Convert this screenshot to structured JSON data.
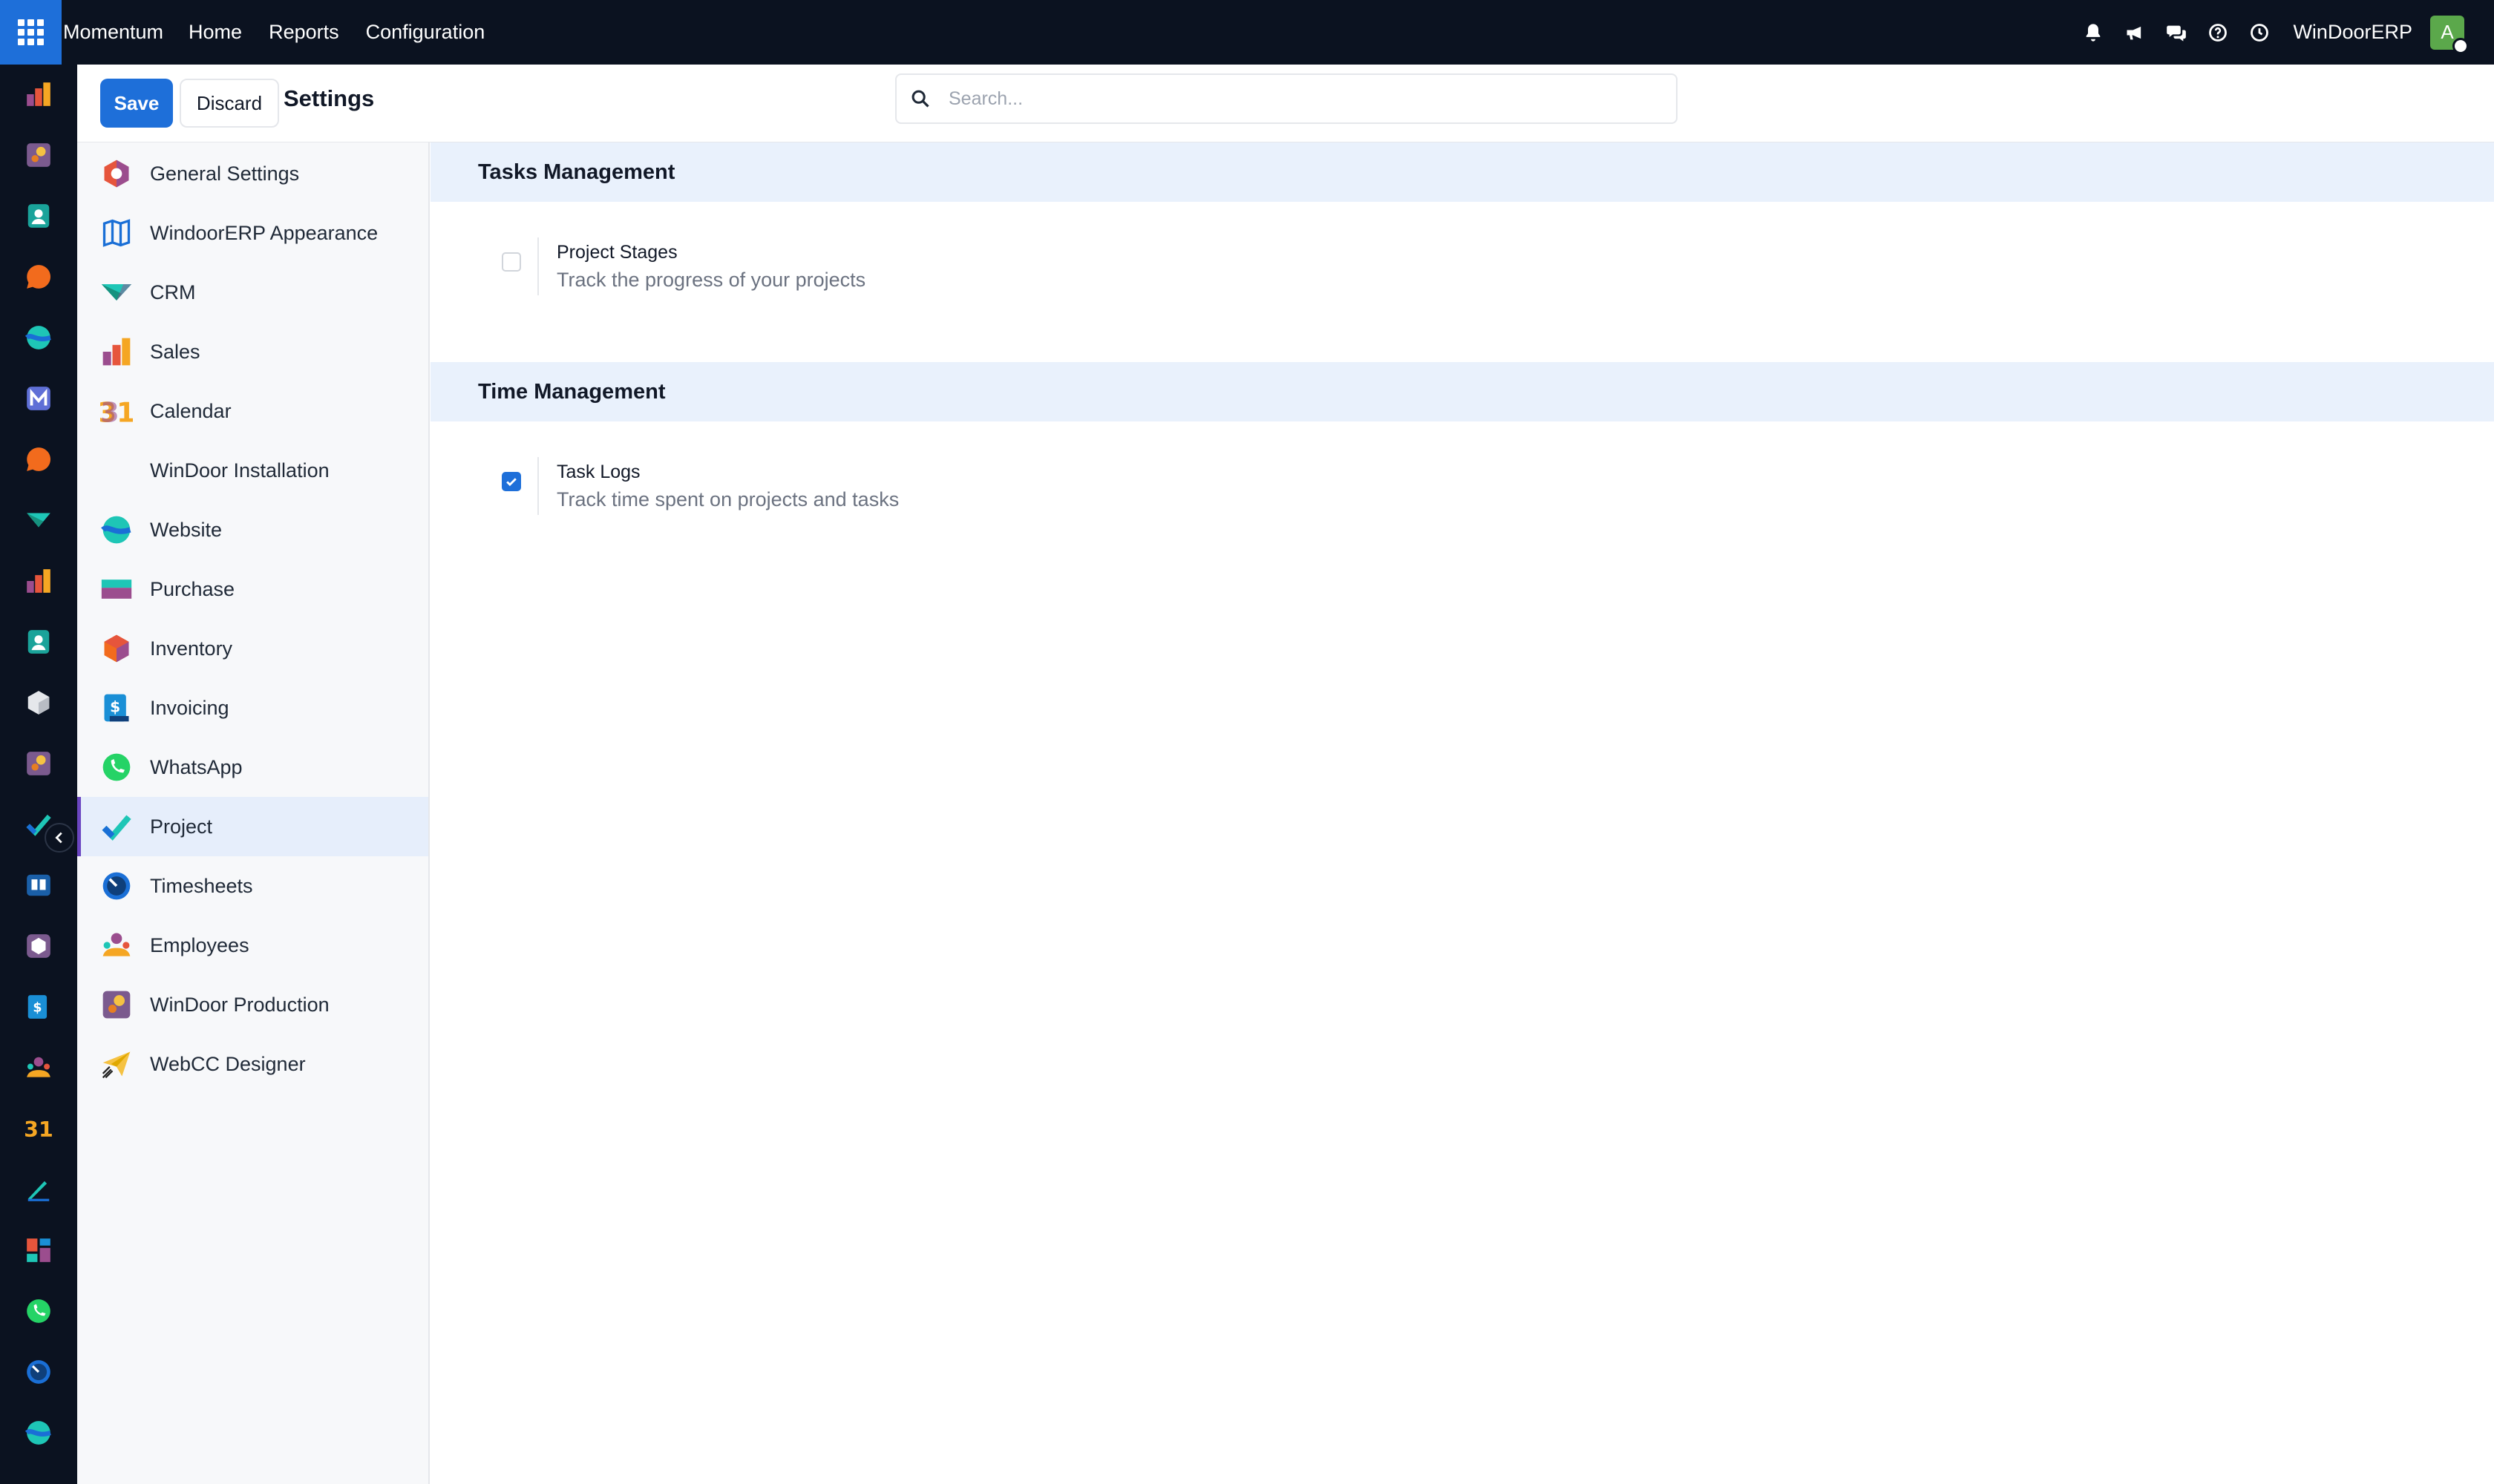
{
  "navbar": {
    "brand": "Momentum",
    "menu": [
      "Home",
      "Reports",
      "Configuration"
    ],
    "company": "WinDoorERP",
    "avatar_initial": "A",
    "icons": [
      "bell-icon",
      "megaphone-icon",
      "chat-icon",
      "help-icon",
      "clock-icon"
    ]
  },
  "control": {
    "save_label": "Save",
    "discard_label": "Discard",
    "title": "Settings",
    "search_placeholder": "Search..."
  },
  "sidebar": {
    "items": [
      {
        "label": "General Settings",
        "icon": "general-settings-icon"
      },
      {
        "label": "WindoorERP Appearance",
        "icon": "appearance-icon"
      },
      {
        "label": "CRM",
        "icon": "crm-icon"
      },
      {
        "label": "Sales",
        "icon": "sales-icon"
      },
      {
        "label": "Calendar",
        "icon": "calendar-icon"
      },
      {
        "label": "WinDoor Installation",
        "icon": ""
      },
      {
        "label": "Website",
        "icon": "website-icon"
      },
      {
        "label": "Purchase",
        "icon": "purchase-icon"
      },
      {
        "label": "Inventory",
        "icon": "inventory-icon"
      },
      {
        "label": "Invoicing",
        "icon": "invoicing-icon"
      },
      {
        "label": "WhatsApp",
        "icon": "whatsapp-icon"
      },
      {
        "label": "Project",
        "icon": "project-icon",
        "active": true
      },
      {
        "label": "Timesheets",
        "icon": "timesheets-icon"
      },
      {
        "label": "Employees",
        "icon": "employees-icon"
      },
      {
        "label": "WinDoor Production",
        "icon": "production-icon"
      },
      {
        "label": "WebCC Designer",
        "icon": "webcc-designer-icon"
      }
    ]
  },
  "sections": [
    {
      "title": "Tasks Management",
      "settings": [
        {
          "title": "Project Stages",
          "description": "Track the progress of your projects",
          "checked": false
        }
      ]
    },
    {
      "title": "Time Management",
      "settings": [
        {
          "title": "Task Logs",
          "description": "Track time spent on projects and tasks",
          "checked": true
        }
      ]
    }
  ],
  "colors": {
    "navbar_bg": "#0b1220",
    "primary": "#1e6fd9",
    "section_bg": "#e9f1fc",
    "active_item_bg": "#e6eefb",
    "active_marker": "#6b46c1"
  }
}
